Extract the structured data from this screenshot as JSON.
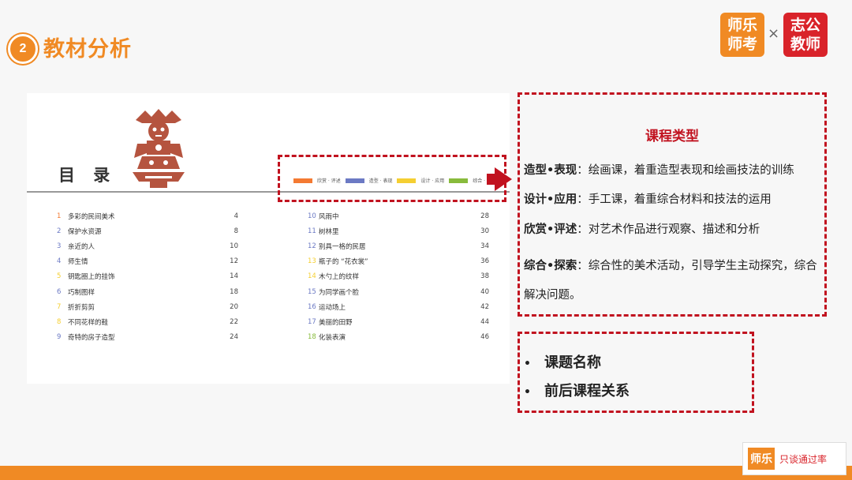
{
  "header": {
    "section_number": "2",
    "section_title": "教材分析",
    "logo_a_line1": "师乐",
    "logo_a_line2": "师考",
    "logo_separator": "×",
    "logo_b_line1": "志公",
    "logo_b_line2": "教师"
  },
  "toc": {
    "title": "目 录",
    "legend": [
      {
        "label": "欣赏 · 评述",
        "color": "#f47a32"
      },
      {
        "label": "造型 · 表现",
        "color": "#6c7ac4"
      },
      {
        "label": "设计 · 应用",
        "color": "#f5cf32"
      },
      {
        "label": "综合 · 探索",
        "color": "#88bb3c"
      }
    ],
    "left": [
      {
        "num": "1",
        "title": "多彩的民间美术",
        "page": "4",
        "color": "#f47a32"
      },
      {
        "num": "2",
        "title": "保护水资源",
        "page": "8",
        "color": "#6c7ac4"
      },
      {
        "num": "3",
        "title": "亲近的人",
        "page": "10",
        "color": "#6c7ac4"
      },
      {
        "num": "4",
        "title": "师生情",
        "page": "12",
        "color": "#6c7ac4"
      },
      {
        "num": "5",
        "title": "钥匙圈上的挂饰",
        "page": "14",
        "color": "#f5cf32"
      },
      {
        "num": "6",
        "title": "巧制图样",
        "page": "18",
        "color": "#6c7ac4"
      },
      {
        "num": "7",
        "title": "折折剪剪",
        "page": "20",
        "color": "#f5cf32"
      },
      {
        "num": "8",
        "title": "不同花样的鞋",
        "page": "22",
        "color": "#f5cf32"
      },
      {
        "num": "9",
        "title": "奇特的房子造型",
        "page": "24",
        "color": "#6c7ac4"
      }
    ],
    "right": [
      {
        "num": "10",
        "title": "风雨中",
        "page": "28",
        "color": "#6c7ac4"
      },
      {
        "num": "11",
        "title": "树林里",
        "page": "30",
        "color": "#6c7ac4"
      },
      {
        "num": "12",
        "title": "别具一格的民居",
        "page": "34",
        "color": "#6c7ac4"
      },
      {
        "num": "13",
        "title": "瓶子的 “花衣裳”",
        "page": "36",
        "color": "#f5cf32"
      },
      {
        "num": "14",
        "title": "木勺上的纹样",
        "page": "38",
        "color": "#f5cf32"
      },
      {
        "num": "15",
        "title": "为同学画个脸",
        "page": "40",
        "color": "#6c7ac4"
      },
      {
        "num": "16",
        "title": "运动场上",
        "page": "42",
        "color": "#6c7ac4"
      },
      {
        "num": "17",
        "title": "美丽的田野",
        "page": "44",
        "color": "#6c7ac4"
      },
      {
        "num": "18",
        "title": "化装表演",
        "page": "46",
        "color": "#88bb3c"
      }
    ]
  },
  "course_types": {
    "title": "课程类型",
    "items": [
      {
        "label": "造型•表现",
        "text": "：绘画课，着重造型表现和绘画技法的训练"
      },
      {
        "label": "设计•应用",
        "text": "：手工课，着重综合材料和技法的运用"
      },
      {
        "label": "欣赏•评述",
        "text": "：对艺术作品进行观察、描述和分析"
      },
      {
        "label": "综合•探索",
        "text": "：综合性的美术活动，引导学生主动探究，综合解决问题。"
      }
    ]
  },
  "bullets": [
    "课题名称",
    "前后课程关系"
  ],
  "footer": {
    "logo": "师乐",
    "slogan": "只谈通过率"
  },
  "icons": {
    "arrow": "arrow-right-icon",
    "papercut": "papercut-figure-icon"
  },
  "colors": {
    "accent": "#f08a24",
    "brand_red": "#d9232a",
    "highlight": "#c1121f"
  }
}
